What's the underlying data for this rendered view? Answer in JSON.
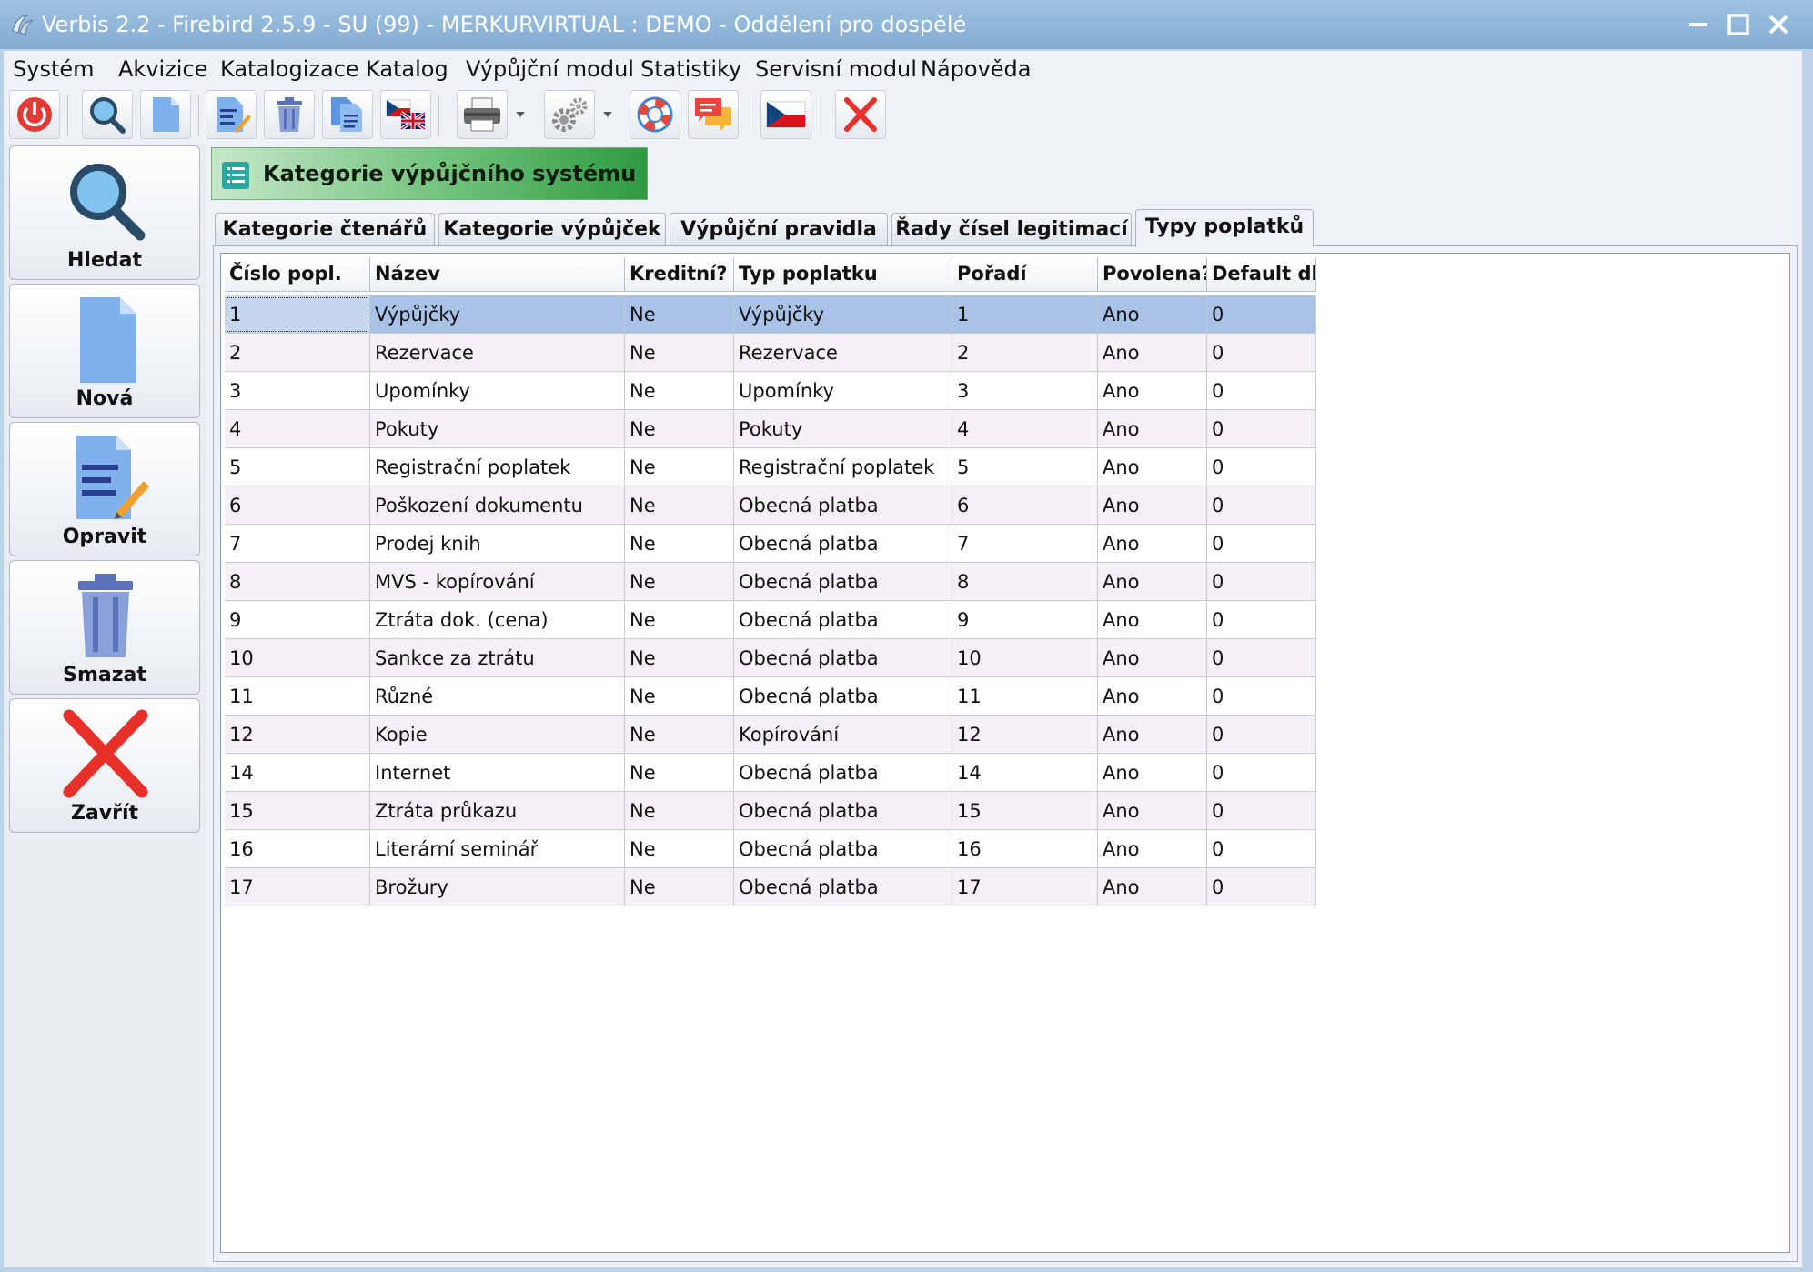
{
  "window": {
    "title": "Verbis 2.2 - Firebird 2.5.9 - SU (99) - MERKURVIRTUAL : DEMO - Oddělení pro dospělé"
  },
  "menu": {
    "items": [
      {
        "label": "Systém"
      },
      {
        "label": "Akvizice"
      },
      {
        "label": "Katalogizace"
      },
      {
        "label": "Katalog"
      },
      {
        "label": "Výpůjční modul"
      },
      {
        "label": "Statistiky"
      },
      {
        "label": "Servisní modul"
      },
      {
        "label": "Nápověda"
      }
    ]
  },
  "toolbar": {
    "icons": [
      "power-icon",
      "search-icon",
      "new-document-icon",
      "edit-document-icon",
      "trash-icon",
      "copy-document-icon",
      "language-flags-icon",
      "printer-icon",
      "settings-icon",
      "help-lifebuoy-icon",
      "messages-icon",
      "czech-flag-icon",
      "close-icon"
    ]
  },
  "sidebar": {
    "buttons": [
      {
        "label": "Hledat",
        "icon": "search-icon"
      },
      {
        "label": "Nová",
        "icon": "new-document-icon"
      },
      {
        "label": "Opravit",
        "icon": "edit-document-icon"
      },
      {
        "label": "Smazat",
        "icon": "trash-icon"
      },
      {
        "label": "Zavřít",
        "icon": "close-icon"
      }
    ]
  },
  "module": {
    "title": "Kategorie výpůjčního systému"
  },
  "tabs": [
    {
      "label": "Kategorie čtenářů",
      "active": false
    },
    {
      "label": "Kategorie výpůjček",
      "active": false
    },
    {
      "label": "Výpůjční pravidla",
      "active": false
    },
    {
      "label": "Řady čísel legitimací",
      "active": false
    },
    {
      "label": "Typy poplatků",
      "active": true
    }
  ],
  "grid": {
    "columns": [
      "Číslo popl.",
      "Název",
      "Kreditní?",
      "Typ poplatku",
      "Pořadí",
      "Povolena?",
      "Default dl"
    ],
    "rows": [
      [
        "1",
        "Výpůjčky",
        "Ne",
        "Výpůjčky",
        "1",
        "Ano",
        "0"
      ],
      [
        "2",
        "Rezervace",
        "Ne",
        "Rezervace",
        "2",
        "Ano",
        "0"
      ],
      [
        "3",
        "Upomínky",
        "Ne",
        "Upomínky",
        "3",
        "Ano",
        "0"
      ],
      [
        "4",
        "Pokuty",
        "Ne",
        "Pokuty",
        "4",
        "Ano",
        "0"
      ],
      [
        "5",
        "Registrační poplatek",
        "Ne",
        "Registrační poplatek",
        "5",
        "Ano",
        "0"
      ],
      [
        "6",
        "Poškození dokumentu",
        "Ne",
        "Obecná platba",
        "6",
        "Ano",
        "0"
      ],
      [
        "7",
        "Prodej knih",
        "Ne",
        "Obecná platba",
        "7",
        "Ano",
        "0"
      ],
      [
        "8",
        "MVS - kopírování",
        "Ne",
        "Obecná platba",
        "8",
        "Ano",
        "0"
      ],
      [
        "9",
        "Ztráta dok. (cena)",
        "Ne",
        "Obecná platba",
        "9",
        "Ano",
        "0"
      ],
      [
        "10",
        "Sankce za ztrátu",
        "Ne",
        "Obecná platba",
        "10",
        "Ano",
        "0"
      ],
      [
        "11",
        "Různé",
        "Ne",
        "Obecná platba",
        "11",
        "Ano",
        "0"
      ],
      [
        "12",
        "Kopie",
        "Ne",
        "Kopírování",
        "12",
        "Ano",
        "0"
      ],
      [
        "14",
        "Internet",
        "Ne",
        "Obecná platba",
        "14",
        "Ano",
        "0"
      ],
      [
        "15",
        "Ztráta průkazu",
        "Ne",
        "Obecná platba",
        "15",
        "Ano",
        "0"
      ],
      [
        "16",
        "Literární seminář",
        "Ne",
        "Obecná platba",
        "16",
        "Ano",
        "0"
      ],
      [
        "17",
        "Brožury",
        "Ne",
        "Obecná platba",
        "17",
        "Ano",
        "0"
      ]
    ],
    "selected_row": 0
  },
  "colors": {
    "title_bar": "#84acd2",
    "selected_row": "#a9c3e6",
    "module_header": "#2f9a42"
  }
}
